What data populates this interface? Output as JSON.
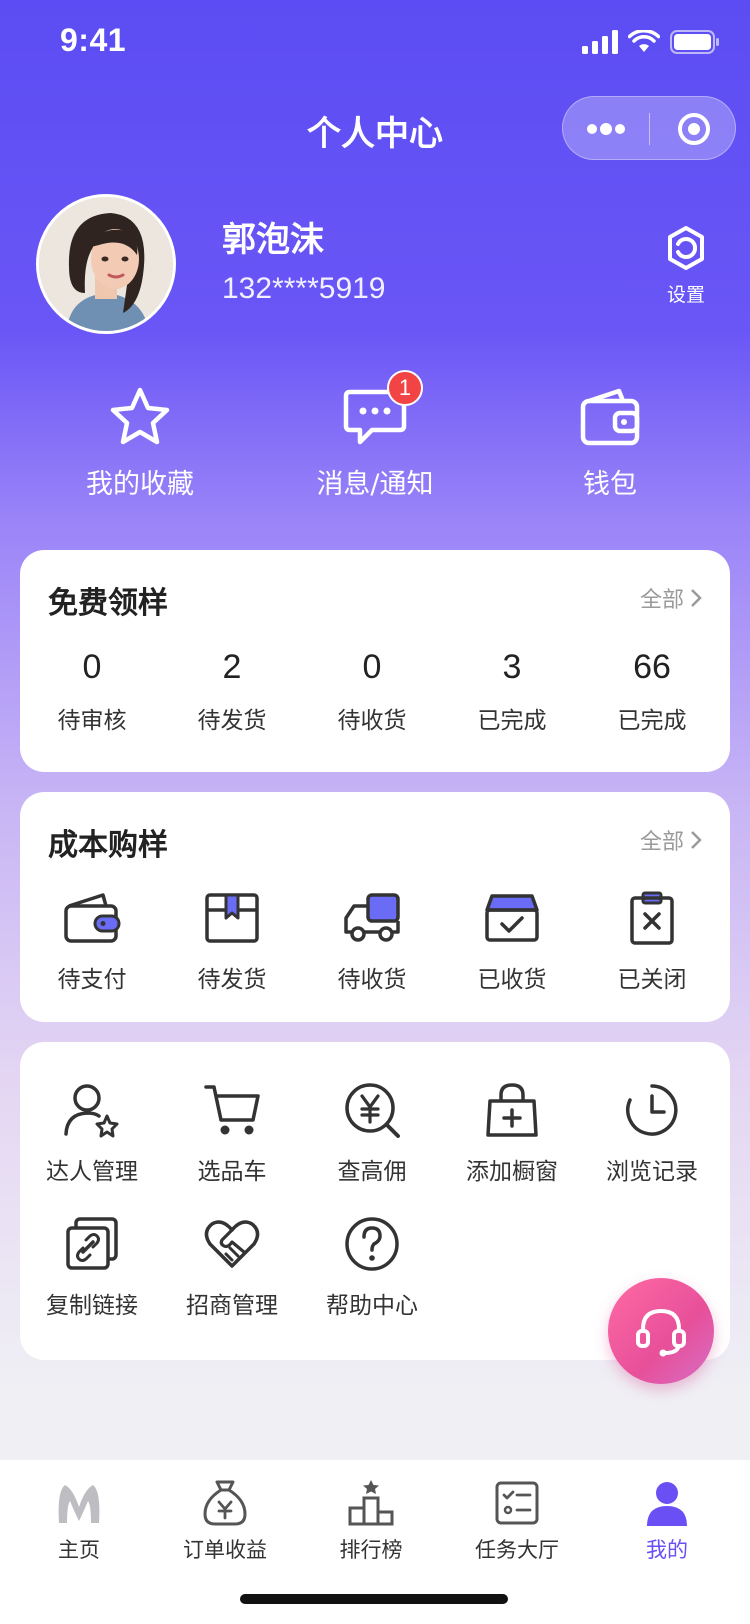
{
  "status_bar": {
    "time": "9:41"
  },
  "nav": {
    "title": "个人中心"
  },
  "profile": {
    "name": "郭泡沫",
    "phone": "132****5919",
    "settings_label": "设置"
  },
  "quick_actions": [
    {
      "label": "我的收藏",
      "icon": "star-icon"
    },
    {
      "label": "消息/通知",
      "icon": "message-icon",
      "badge": "1"
    },
    {
      "label": "钱包",
      "icon": "wallet-icon"
    }
  ],
  "free_sample": {
    "title": "免费领样",
    "more": "全部",
    "stats": [
      {
        "value": "0",
        "label": "待审核"
      },
      {
        "value": "2",
        "label": "待发货"
      },
      {
        "value": "0",
        "label": "待收货"
      },
      {
        "value": "3",
        "label": "已完成"
      },
      {
        "value": "66",
        "label": "已完成"
      }
    ]
  },
  "cost_sample": {
    "title": "成本购样",
    "more": "全部",
    "items": [
      {
        "label": "待支付",
        "icon": "wallet-pay-icon"
      },
      {
        "label": "待发货",
        "icon": "package-icon"
      },
      {
        "label": "待收货",
        "icon": "truck-icon"
      },
      {
        "label": "已收货",
        "icon": "box-check-icon"
      },
      {
        "label": "已关闭",
        "icon": "clipboard-close-icon"
      }
    ]
  },
  "tools": {
    "items": [
      {
        "label": "达人管理",
        "icon": "user-star-icon"
      },
      {
        "label": "选品车",
        "icon": "cart-icon"
      },
      {
        "label": "查高佣",
        "icon": "yen-search-icon"
      },
      {
        "label": "添加橱窗",
        "icon": "bag-add-icon"
      },
      {
        "label": "浏览记录",
        "icon": "clock-icon"
      },
      {
        "label": "复制链接",
        "icon": "link-copy-icon"
      },
      {
        "label": "招商管理",
        "icon": "handshake-icon"
      },
      {
        "label": "帮助中心",
        "icon": "help-icon"
      }
    ]
  },
  "tabbar": {
    "items": [
      {
        "label": "主页",
        "icon": "home-logo-icon"
      },
      {
        "label": "订单收益",
        "icon": "money-bag-icon"
      },
      {
        "label": "排行榜",
        "icon": "ranking-icon"
      },
      {
        "label": "任务大厅",
        "icon": "task-list-icon"
      },
      {
        "label": "我的",
        "icon": "profile-icon",
        "active": true
      }
    ]
  },
  "colors": {
    "brand": "#6a4ff5",
    "badge": "#f24444",
    "service_button": "#e7509a"
  }
}
